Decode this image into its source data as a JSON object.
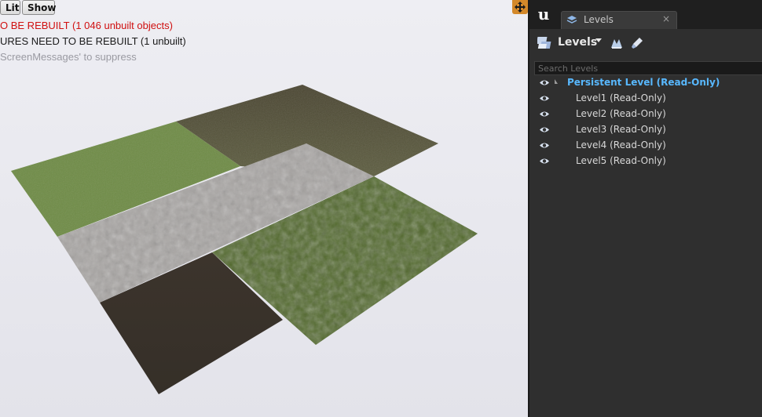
{
  "viewport": {
    "buttons": [
      "Lit",
      "Show"
    ],
    "messages": [
      "O BE REBUILT (1 046 unbuilt objects)",
      "URES NEED TO BE REBUILT (1 unbuilt)",
      "ScreenMessages' to suppress"
    ],
    "colors": {
      "error": "#d01010",
      "floor_grass": "#6f8b45",
      "floor_dark_olive": "#525539",
      "floor_concrete": "#a5a2a0",
      "floor_moss": "#4d6329",
      "floor_dark": "#3b342d"
    }
  },
  "panel": {
    "tab": {
      "label": "Levels",
      "close": "×"
    },
    "toolbar": {
      "levels_menu_label": "Levels"
    },
    "search": {
      "placeholder": "Search Levels",
      "value": ""
    },
    "levels": [
      {
        "label": "Persistent Level (Read-Only)",
        "persistent": true,
        "visible": true
      },
      {
        "label": "Level1 (Read-Only)",
        "persistent": false,
        "visible": true
      },
      {
        "label": "Level2 (Read-Only)",
        "persistent": false,
        "visible": true
      },
      {
        "label": "Level3 (Read-Only)",
        "persistent": false,
        "visible": true
      },
      {
        "label": "Level4 (Read-Only)",
        "persistent": false,
        "visible": true
      },
      {
        "label": "Level5 (Read-Only)",
        "persistent": false,
        "visible": true
      }
    ],
    "colors": {
      "persistent_text": "#58b8ff",
      "tab_background": "#3a3a3a",
      "panel_background": "#2f2f2f"
    }
  }
}
